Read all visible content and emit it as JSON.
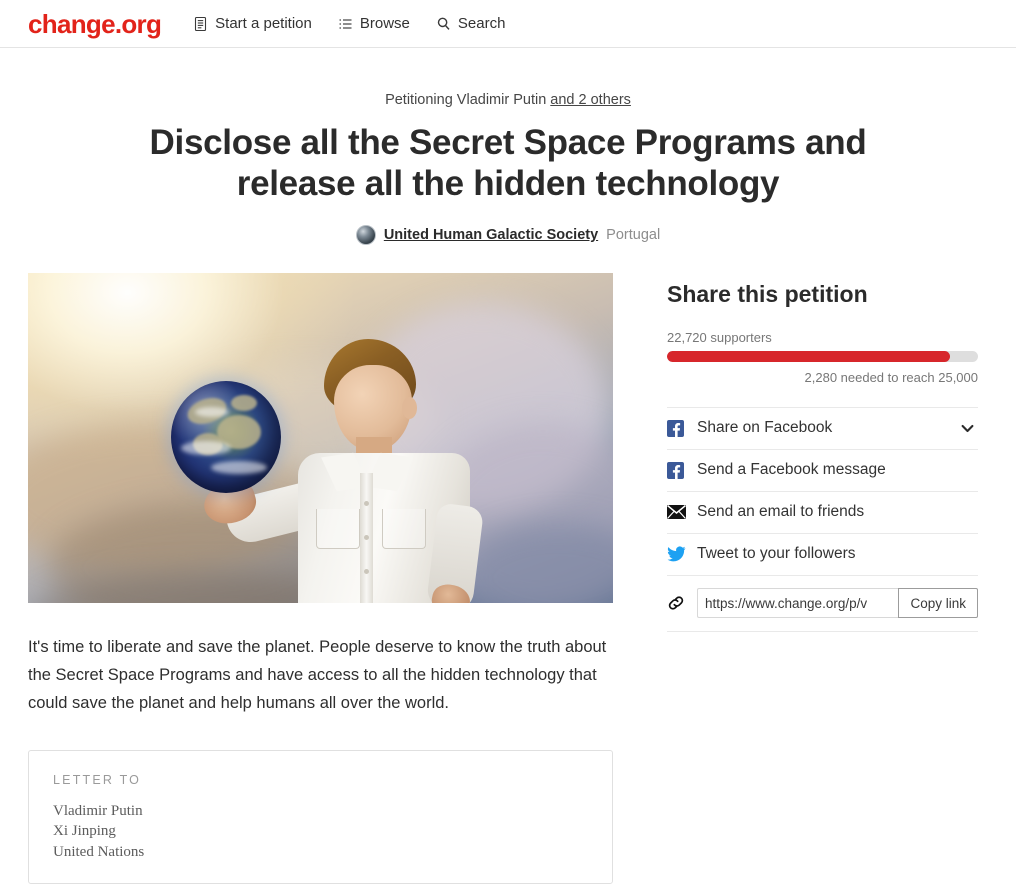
{
  "header": {
    "logo": "change.org",
    "nav": [
      {
        "label": "Start a petition",
        "icon": "document-icon"
      },
      {
        "label": "Browse",
        "icon": "list-icon"
      },
      {
        "label": "Search",
        "icon": "search-icon"
      }
    ]
  },
  "petition": {
    "petitioning_prefix": "Petitioning Vladimir Putin",
    "petitioning_more": "and 2 others",
    "title": "Disclose all the Secret Space Programs and release all the hidden technology",
    "author_name": "United Human Galactic Society",
    "author_location": "Portugal",
    "hero_alt": "Boy in white shirt holding planet Earth above clouds",
    "summary": "It's time to liberate and save the planet. People deserve to know the truth about the Secret Space Programs and have access to all the hidden technology that could save the planet and help humans all over the world.",
    "letter_label": "LETTER TO",
    "recipients": [
      "Vladimir Putin",
      "Xi Jinping",
      "United Nations"
    ]
  },
  "share": {
    "title": "Share this petition",
    "supporters_text": "22,720 supporters",
    "needed_text": "2,280 needed to reach 25,000",
    "supporters_count": 22720,
    "goal": 25000,
    "needed": 2280,
    "progress_percent": 90.9,
    "options": [
      {
        "label": "Share on Facebook",
        "icon": "facebook-icon",
        "has_chevron": true,
        "chevron": "⌄"
      },
      {
        "label": "Send a Facebook message",
        "icon": "facebook-icon",
        "has_chevron": false,
        "chevron": ""
      },
      {
        "label": "Send an email to friends",
        "icon": "envelope-icon",
        "has_chevron": false,
        "chevron": ""
      },
      {
        "label": "Tweet to your followers",
        "icon": "twitter-icon",
        "has_chevron": false,
        "chevron": ""
      }
    ],
    "link_icon": "link-icon",
    "url_value": "https://www.change.org/p/v",
    "copy_label": "Copy link"
  },
  "colors": {
    "brand_red": "#e2231a",
    "progress_red": "#d7262b",
    "facebook_blue": "#3b5998",
    "twitter_blue": "#1da1f2"
  }
}
